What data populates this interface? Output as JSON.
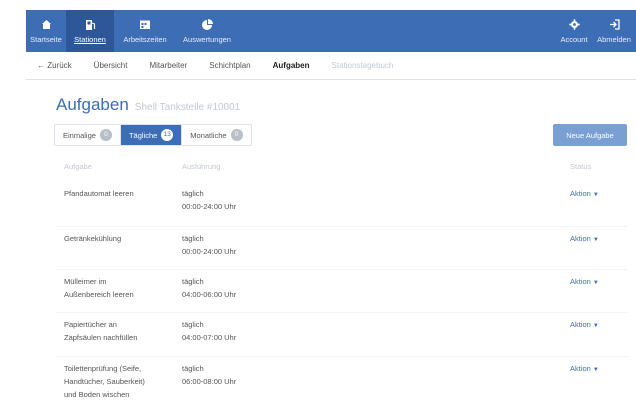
{
  "topnav": {
    "items": [
      {
        "label": "Startseite",
        "icon": "home-icon"
      },
      {
        "label": "Stationen",
        "icon": "station-icon",
        "active": true
      },
      {
        "label": "Arbeitszeiten",
        "icon": "calendar-icon"
      },
      {
        "label": "Auswertungen",
        "icon": "pie-chart-icon"
      }
    ],
    "right": [
      {
        "label": "Account",
        "icon": "gear-icon"
      },
      {
        "label": "Abmelden",
        "icon": "logout-icon"
      }
    ]
  },
  "subnav": {
    "back": "← Zurück",
    "items": [
      "Übersicht",
      "Mitarbeiter",
      "Schichtplan",
      "Aufgaben",
      "Stationstagebuch"
    ],
    "active": "Aufgaben"
  },
  "page": {
    "title": "Aufgaben",
    "subtitle": "Shell Tankstelle #10001"
  },
  "tabs": [
    {
      "label": "Einmalige",
      "count": "0"
    },
    {
      "label": "Tägliche",
      "count": "13"
    },
    {
      "label": "Monatliche",
      "count": "0"
    }
  ],
  "new_button": "Neue Aufgabe",
  "table": {
    "headers": {
      "task": "Aufgabe",
      "exec": "Ausführung",
      "status": "Status"
    },
    "action_label": "Aktion",
    "rows": [
      {
        "task": [
          "Pfandautomat leeren"
        ],
        "exec": [
          "täglich",
          "00:00-24:00 Uhr"
        ]
      },
      {
        "task": [
          "Getränkekühlung"
        ],
        "exec": [
          "täglich",
          "00:00-24:00 Uhr"
        ]
      },
      {
        "task": [
          "Mülleimer im",
          "Außenbereich leeren"
        ],
        "exec": [
          "täglich",
          "04:00-06:00 Uhr"
        ]
      },
      {
        "task": [
          "Papiertücher an",
          "Zapfsäulen nachfüllen"
        ],
        "exec": [
          "täglich",
          "04:00-07:00 Uhr"
        ]
      },
      {
        "task": [
          "Toilettenprüfung (Seife,",
          "Handtücher, Sauberkeit)",
          "und Boden wischen"
        ],
        "exec": [
          "täglich",
          "06:00-08:00 Uhr"
        ]
      }
    ]
  },
  "colors": {
    "primary": "#3d6db5",
    "primary_dark": "#2e5799",
    "button": "#7a9fd3"
  }
}
